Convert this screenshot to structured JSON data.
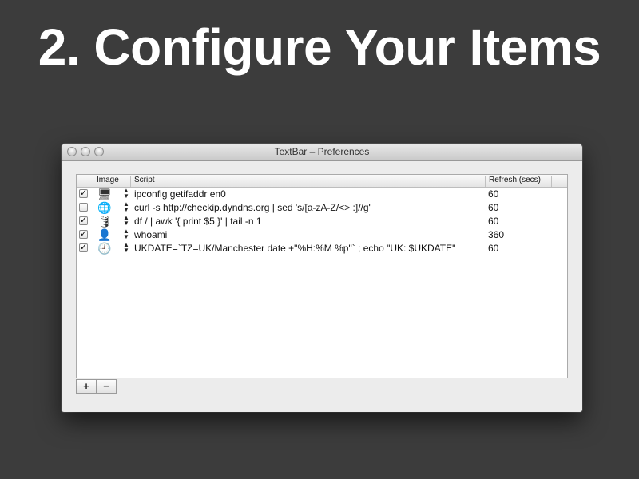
{
  "slide": {
    "title": "2. Configure Your Items"
  },
  "window": {
    "title": "TextBar – Preferences"
  },
  "table": {
    "columns": {
      "image": "Image",
      "script": "Script",
      "refresh": "Refresh (secs)"
    },
    "rows": [
      {
        "checked": true,
        "icon": "monitor-icon",
        "script": "ipconfig getifaddr en0",
        "refresh": "60"
      },
      {
        "checked": false,
        "icon": "globe-icon",
        "script": "curl -s http://checkip.dyndns.org | sed 's/[a-zA-Z/<> :]//g'",
        "refresh": "60"
      },
      {
        "checked": true,
        "icon": "disk-icon",
        "script": "df / | awk '{ print $5 }' | tail -n 1",
        "refresh": "60"
      },
      {
        "checked": true,
        "icon": "user-icon",
        "script": "whoami",
        "refresh": "360"
      },
      {
        "checked": true,
        "icon": "clock-icon",
        "script": "UKDATE=`TZ=UK/Manchester date +\"%H:%M %p\"` ; echo \"UK: $UKDATE\"",
        "refresh": "60"
      }
    ]
  },
  "buttons": {
    "add": "+",
    "remove": "−"
  }
}
